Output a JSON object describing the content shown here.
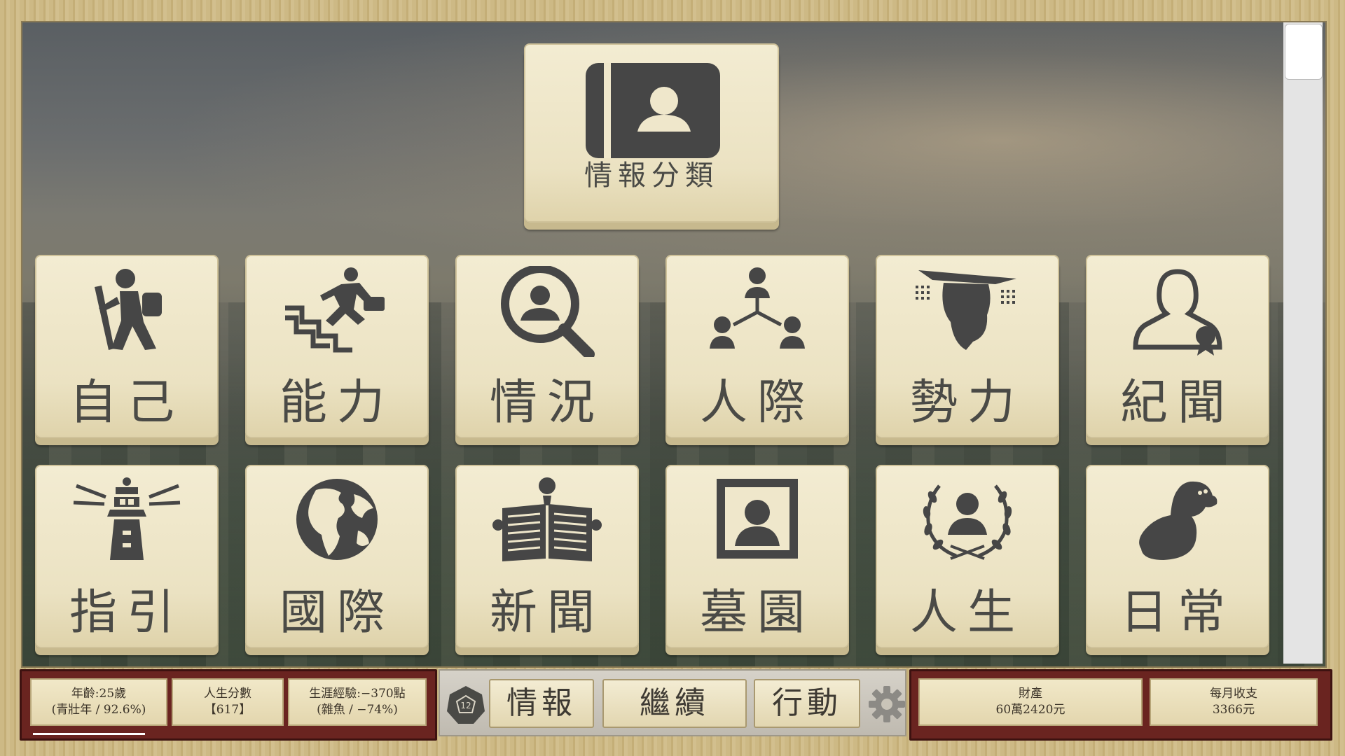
{
  "main_menu": {
    "category_tile": {
      "label": "情報分類",
      "icon": "contact-book-icon"
    },
    "tiles": [
      {
        "label": "自己",
        "icon": "hiker-icon"
      },
      {
        "label": "能力",
        "icon": "climbing-stairs-icon"
      },
      {
        "label": "情況",
        "icon": "magnifier-person-icon"
      },
      {
        "label": "人際",
        "icon": "people-network-icon"
      },
      {
        "label": "勢力",
        "icon": "scholar-head-icon"
      },
      {
        "label": "紀聞",
        "icon": "person-badge-icon"
      },
      {
        "label": "指引",
        "icon": "lighthouse-icon"
      },
      {
        "label": "國際",
        "icon": "globe-icon"
      },
      {
        "label": "新聞",
        "icon": "newspaper-reader-icon"
      },
      {
        "label": "墓園",
        "icon": "portrait-frame-icon"
      },
      {
        "label": "人生",
        "icon": "laurel-person-icon"
      },
      {
        "label": "日常",
        "icon": "monkey-icon"
      }
    ]
  },
  "status": {
    "age_line1": "年齡:25歲",
    "age_line2": "(青壯年 / 92.6%)",
    "score_line1": "人生分數",
    "score_line2": "【617】",
    "exp_line1": "生涯經驗:−370點",
    "exp_line2": "(雜魚 / −74%)"
  },
  "commands": {
    "info": "情報",
    "continue": "繼續",
    "action": "行動",
    "dice_icon": "d12-dice-icon",
    "settings_icon": "gear-icon"
  },
  "finance": {
    "assets_label": "財產",
    "assets_value": "60萬2420元",
    "monthly_label": "每月收支",
    "monthly_value": "3366元"
  },
  "colors": {
    "tile_bg": "#efe7cb",
    "icon_dark": "#464646",
    "panel_red": "#6a2420"
  }
}
